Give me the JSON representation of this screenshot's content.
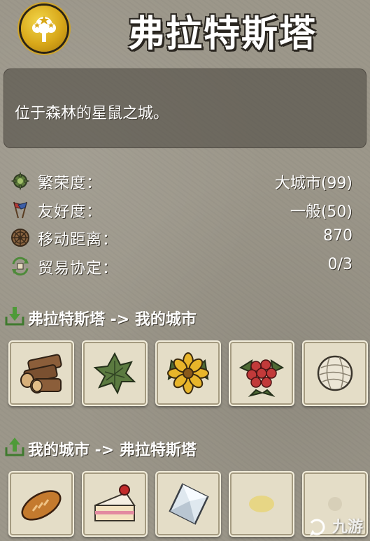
{
  "city": {
    "name": "弗拉特斯塔",
    "description": "位于森林的星鼠之城。"
  },
  "stats": [
    {
      "icon": "prosperity-icon",
      "label": "繁荣度：",
      "value": "大城市(99)"
    },
    {
      "icon": "friendship-flags-icon",
      "label": "友好度：",
      "value": "一般(50)"
    },
    {
      "icon": "wheel-icon",
      "label": "移动距离：",
      "value": "870"
    },
    {
      "icon": "trade-agreement-icon",
      "label": "贸易协定：",
      "value": "0/3"
    }
  ],
  "exports": {
    "title": "弗拉特斯塔 -> 我的城市",
    "items": [
      "logs-icon",
      "herb-leaves-icon",
      "yellow-flower-icon",
      "raspberry-icon",
      "thread-ball-icon"
    ]
  },
  "imports": {
    "title": "我的城市 -> 弗拉特斯塔",
    "items": [
      "bread-icon",
      "cake-slice-icon",
      "crystal-icon",
      "yellow-item-icon",
      "unknown-item-icon"
    ]
  },
  "watermark": {
    "text": "九游"
  },
  "colors": {
    "background": "#9c978a",
    "slot": "#e4ddc7",
    "emblem_gold": "#d8a81a"
  }
}
